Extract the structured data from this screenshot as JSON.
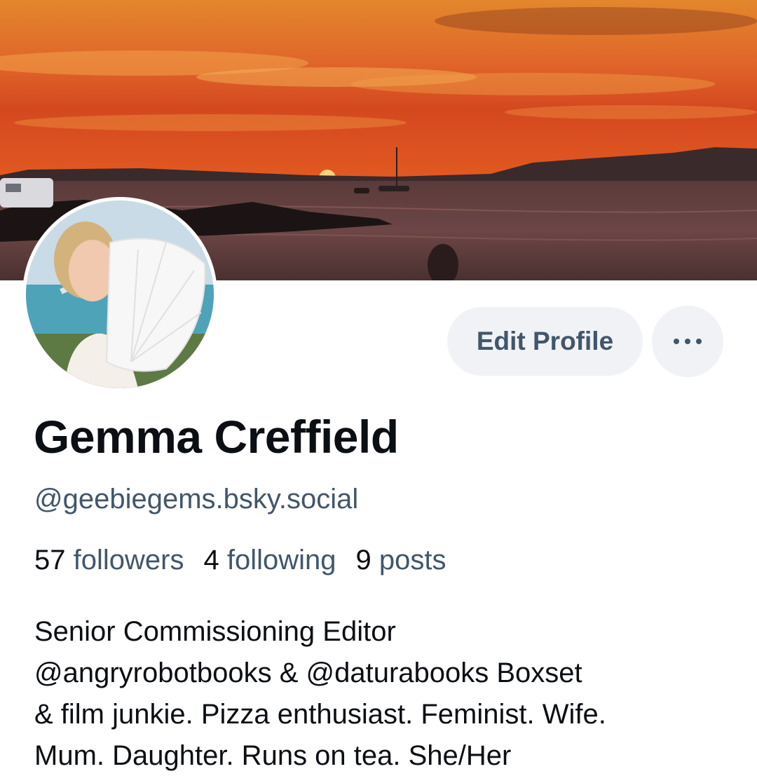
{
  "profile": {
    "display_name": "Gemma Creffield",
    "handle": "@geebiegems.bsky.social",
    "stats": {
      "followers_count": "57",
      "followers_label": "followers",
      "following_count": "4",
      "following_label": "following",
      "posts_count": "9",
      "posts_label": "posts"
    },
    "bio_lines": [
      "Senior Commissioning Editor",
      "@angryrobotbooks & @daturabooks Boxset",
      "& film junkie. Pizza enthusiast. Feminist. Wife.",
      "Mum. Daughter. Runs on tea. She/Her"
    ]
  },
  "actions": {
    "edit_profile_label": "Edit Profile",
    "more_icon": "ellipsis-icon"
  },
  "colors": {
    "text_primary": "#0b0f14",
    "text_secondary": "#42566b",
    "button_bg": "#f0f2f5"
  }
}
